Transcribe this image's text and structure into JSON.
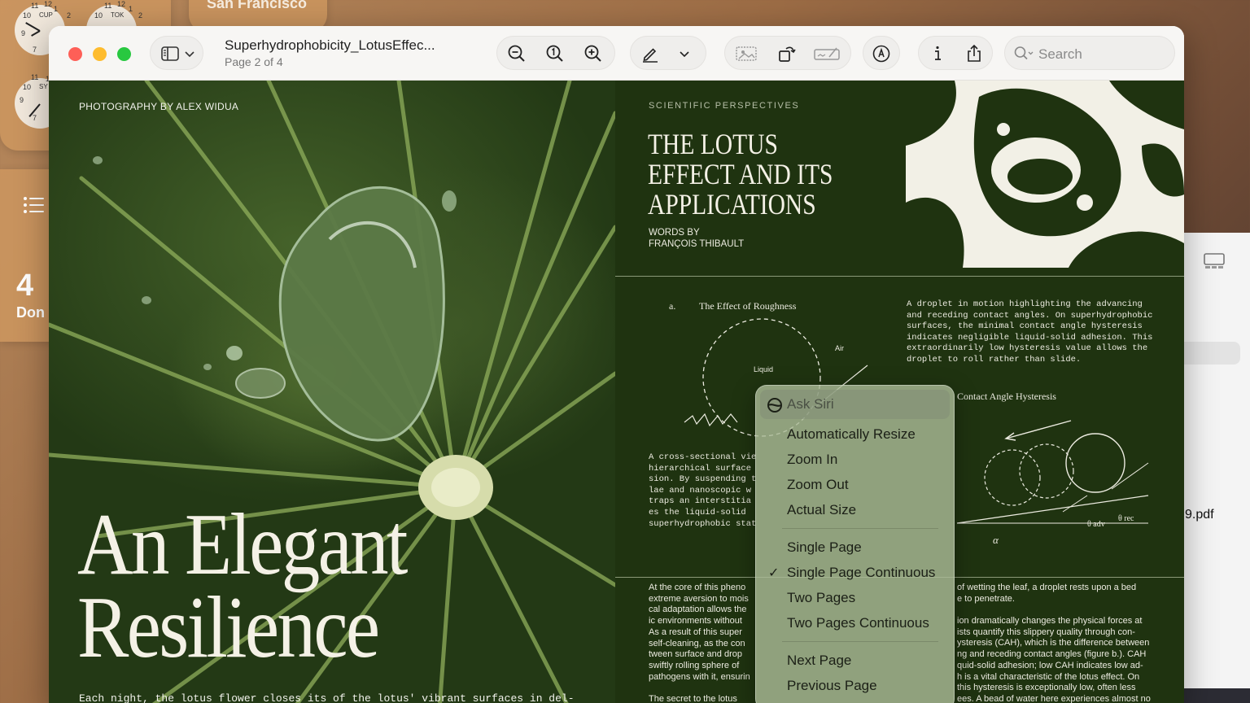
{
  "desktop": {
    "city_label": "San Francisco",
    "clock1": {
      "label": "CUP",
      "nums": [
        "11",
        "12",
        "1",
        "10",
        "2",
        "9",
        "7"
      ]
    },
    "clock2": {
      "label": "SY",
      "nums": [
        "11",
        "12",
        "10",
        "9",
        "7"
      ]
    },
    "clock3": {
      "label": "TOK",
      "nums": [
        "11",
        "12",
        "1",
        "10",
        "2"
      ]
    },
    "reminders_count": "4",
    "reminders_label": "Don",
    "right_file_suffix": "9.pdf"
  },
  "window": {
    "document_title": "Superhydrophobicity_LotusEffec...",
    "page_indicator": "Page 2 of 4",
    "search_placeholder": "Search"
  },
  "page_left": {
    "photo_credit": "PHOTOGRAPHY BY ALEX WIDUA",
    "title_line1": "An Elegant",
    "title_line2": "Resilience",
    "footer_text": "Each night, the lotus flower closes its  of the lotus' vibrant surfaces in del-"
  },
  "page_right": {
    "section": "SCIENTIFIC PERSPECTIVES",
    "title": "The Lotus Effect and Its Applications",
    "words_by": "WORDS BY",
    "author": "FRANÇOIS THIBAULT",
    "fig_a_label": "a.",
    "fig_a_title": "The Effect of Roughness",
    "fig_a_air": "Air",
    "fig_a_liquid": "Liquid",
    "fig_b_title": "Contact Angle Hysteresis",
    "fig_b_theta_adv": "θ adv",
    "fig_b_theta_rec": "θ rec",
    "fig_b_alpha": "α",
    "caption_right": [
      "A droplet in motion highlighting the advancing",
      "and receding contact angles. On superhydrophobic",
      "surfaces, the minimal contact angle hysteresis",
      "indicates negligible liquid-solid adhesion. This",
      "extraordinarily low hysteresis value allows the",
      "droplet to roll rather than slide."
    ],
    "caption_left": [
      "A cross-sectional vie",
      "hierarchical surface",
      "sion. By suspending t",
      "lae and nanoscopic w",
      "traps an interstitia",
      "es the liquid-solid",
      "superhydrophobic stat"
    ],
    "body_left": [
      "At the core of this pheno",
      "extreme aversion to mois",
      "cal adaptation allows the",
      "ic environments without",
      "As a result of this super",
      "self-cleaning, as the con",
      "tween surface and drop",
      "swiftly rolling sphere of",
      "pathogens with it, ensurin",
      "",
      "The secret to the lotus"
    ],
    "body_right_top": [
      "of wetting the leaf, a droplet rests upon a bed",
      "e to penetrate."
    ],
    "body_right": [
      "ion dramatically changes the physical forces at",
      "ists quantify this slippery quality through con-",
      "ysteresis (CAH), which is the difference between",
      "ng and receding contact angles (figure b.). CAH",
      "quid-solid adhesion; low CAH indicates low ad-",
      "h is a vital characteristic of the lotus effect. On",
      " this hysteresis is exceptionally low, often less",
      "ees. A bead of water here experiences almost no"
    ]
  },
  "context_menu": {
    "ask_siri": "Ask Siri",
    "automatically_resize": "Automatically Resize",
    "zoom_in": "Zoom In",
    "zoom_out": "Zoom Out",
    "actual_size": "Actual Size",
    "single_page": "Single Page",
    "single_page_continuous": "Single Page Continuous",
    "two_pages": "Two Pages",
    "two_pages_continuous": "Two Pages Continuous",
    "next_page": "Next Page",
    "previous_page": "Previous Page",
    "checkmark": "✓"
  }
}
